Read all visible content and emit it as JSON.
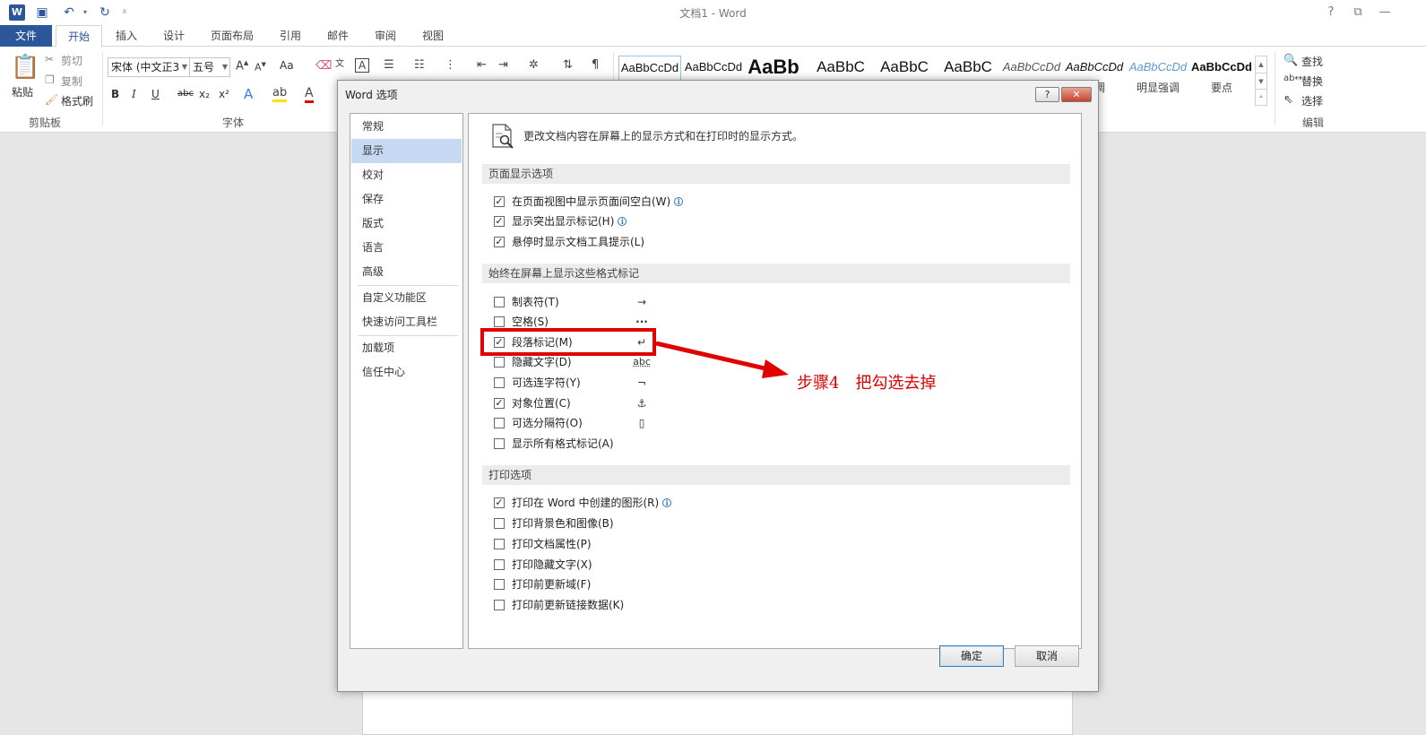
{
  "app": {
    "title": "文档1 - Word",
    "logo_text": "W"
  },
  "window_controls": {
    "help": "?",
    "restore": "⧉",
    "minimize": "—"
  },
  "tabs": [
    "文件",
    "开始",
    "插入",
    "设计",
    "页面布局",
    "引用",
    "邮件",
    "审阅",
    "视图"
  ],
  "ribbon": {
    "clipboard": {
      "paste": "粘贴",
      "cut": "剪切",
      "copy": "复制",
      "format_painter": "格式刷",
      "label": "剪贴板"
    },
    "font": {
      "font_name": "宋体 (中文正3",
      "font_size": "五号",
      "label": "字体",
      "change_case": "Aa",
      "bold": "B",
      "italic": "I",
      "underline": "U",
      "strike": "abc",
      "subscript": "x₂",
      "superscript": "x²"
    },
    "styles": [
      {
        "sample": "AaBbCcDd",
        "name": ""
      },
      {
        "sample": "AaBbCcDd",
        "name": ""
      },
      {
        "sample": "AaBb",
        "name": ""
      },
      {
        "sample": "AaBbC",
        "name": ""
      },
      {
        "sample": "AaBbC",
        "name": ""
      },
      {
        "sample": "AaBbC",
        "name": ""
      },
      {
        "sample": "AaBbCcDd",
        "name": ""
      },
      {
        "sample": "AaBbCcDd",
        "name": "强调"
      },
      {
        "sample": "AaBbCcDd",
        "name": "明显强调"
      },
      {
        "sample": "AaBbCcDd",
        "name": "要点"
      }
    ],
    "editing": {
      "find": "查找",
      "replace": "替换",
      "select": "选择",
      "label": "编辑"
    }
  },
  "dialog": {
    "title": "Word 选项",
    "help_button": "?",
    "close_button": "✕",
    "nav": [
      "常规",
      "显示",
      "校对",
      "保存",
      "版式",
      "语言",
      "高级",
      "自定义功能区",
      "快速访问工具栏",
      "加载项",
      "信任中心"
    ],
    "selected_nav": "显示",
    "header": "更改文档内容在屏幕上的显示方式和在打印时的显示方式。",
    "sections": {
      "page_display": {
        "title": "页面显示选项",
        "options": [
          {
            "label": "在页面视图中显示页面间空白(W)",
            "checked": true,
            "info": "i"
          },
          {
            "label": "显示突出显示标记(H)",
            "checked": true,
            "info": "i"
          },
          {
            "label": "悬停时显示文档工具提示(L)",
            "checked": true
          }
        ]
      },
      "formatting_marks": {
        "title": "始终在屏幕上显示这些格式标记",
        "options": [
          {
            "label": "制表符(T)",
            "checked": false,
            "symbol": "→"
          },
          {
            "label": "空格(S)",
            "checked": false,
            "symbol": "···"
          },
          {
            "label": "段落标记(M)",
            "checked": true,
            "symbol": "↵"
          },
          {
            "label": "隐藏文字(D)",
            "checked": false,
            "symbol": "abc"
          },
          {
            "label": "可选连字符(Y)",
            "checked": false,
            "symbol": "¬"
          },
          {
            "label": "对象位置(C)",
            "checked": true,
            "symbol": "⚓"
          },
          {
            "label": "可选分隔符(O)",
            "checked": false,
            "symbol": "▯"
          },
          {
            "label": "显示所有格式标记(A)",
            "checked": false
          }
        ]
      },
      "print": {
        "title": "打印选项",
        "options": [
          {
            "label": "打印在 Word 中创建的图形(R)",
            "checked": true,
            "info": "i"
          },
          {
            "label": "打印背景色和图像(B)",
            "checked": false
          },
          {
            "label": "打印文档属性(P)",
            "checked": false
          },
          {
            "label": "打印隐藏文字(X)",
            "checked": false
          },
          {
            "label": "打印前更新域(F)",
            "checked": false
          },
          {
            "label": "打印前更新链接数据(K)",
            "checked": false
          }
        ]
      }
    },
    "ok": "确定",
    "cancel": "取消"
  },
  "annotation": {
    "text": "步骤4　把勾选去掉",
    "color": "#e00000"
  },
  "colors": {
    "accent": "#2b579a",
    "nav_selected": "#c5daf2"
  }
}
